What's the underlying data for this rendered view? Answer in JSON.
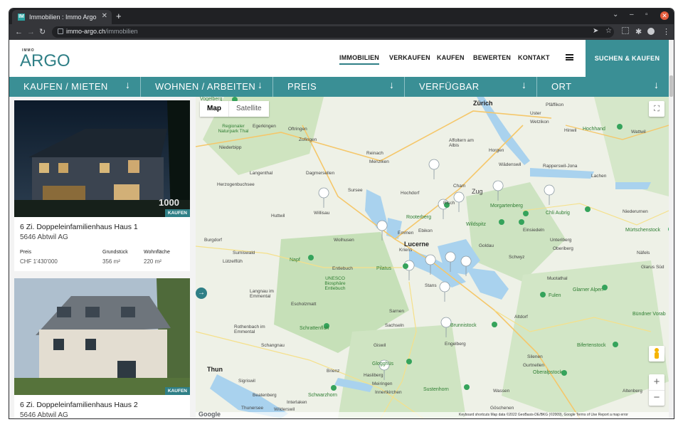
{
  "browser": {
    "tab_title": "Immobilien : Immo Argo",
    "favicon_text": "IM",
    "url_host": "immo-argo.ch",
    "url_path": "/immobilien"
  },
  "site": {
    "logo_small": "IMMO",
    "logo": "ARGO",
    "nav": [
      {
        "label": "IMMOBILIEN",
        "active": true
      },
      {
        "label": "VERKAUFEN",
        "active": false
      },
      {
        "label": "KAUFEN",
        "active": false
      },
      {
        "label": "BEWERTEN",
        "active": false
      },
      {
        "label": "KONTAKT",
        "active": false
      }
    ],
    "cta": "SUCHEN & KAUFEN"
  },
  "filters": [
    {
      "label": "KAUFEN / MIETEN"
    },
    {
      "label": "WOHNEN / ARBEITEN"
    },
    {
      "label": "PREIS"
    },
    {
      "label": "VERFÜGBAR"
    },
    {
      "label": "ORT"
    }
  ],
  "listings": [
    {
      "title": "6 Zi. Doppeleinfamilienhaus Haus 1",
      "location": "5646 Abtwil AG",
      "badge": "KAUFEN",
      "watermark": "1000",
      "specs": {
        "price_label": "Preis",
        "price": "CHF 1'430'000",
        "plot_label": "Grundstück",
        "plot": "356 m²",
        "living_label": "Wohnfläche",
        "living": "220 m²"
      }
    },
    {
      "title": "6 Zi. Doppeleinfamilienhaus Haus 2",
      "location": "5646 Abtwil AG",
      "badge": "KAUFEN"
    }
  ],
  "map": {
    "toggle": {
      "map": "Map",
      "satellite": "Satellite"
    },
    "zoom_in": "+",
    "zoom_out": "−",
    "labels": [
      {
        "text": "Zürich",
        "cls": "city"
      },
      {
        "text": "Lucerne",
        "cls": "city"
      },
      {
        "text": "Thun",
        "cls": "city"
      },
      {
        "text": "Vogelberg",
        "cls": "green"
      },
      {
        "text": "Regionaler Naturpark Thal",
        "cls": "park"
      },
      {
        "text": "Egerkingen",
        "cls": ""
      },
      {
        "text": "Oftringen",
        "cls": ""
      },
      {
        "text": "Niederbipp",
        "cls": ""
      },
      {
        "text": "Zofingen",
        "cls": ""
      },
      {
        "text": "Reinach",
        "cls": ""
      },
      {
        "text": "Menziken",
        "cls": ""
      },
      {
        "text": "Langenthal",
        "cls": ""
      },
      {
        "text": "Dagmersellen",
        "cls": ""
      },
      {
        "text": "Herzogenbuchsee",
        "cls": ""
      },
      {
        "text": "Sursee",
        "cls": ""
      },
      {
        "text": "Hochdorf",
        "cls": ""
      },
      {
        "text": "Huttwil",
        "cls": ""
      },
      {
        "text": "Willisau",
        "cls": ""
      },
      {
        "text": "Burgdorf",
        "cls": ""
      },
      {
        "text": "Sumiswald",
        "cls": ""
      },
      {
        "text": "Lützelflüh",
        "cls": ""
      },
      {
        "text": "Wolhusen",
        "cls": ""
      },
      {
        "text": "Emmen",
        "cls": ""
      },
      {
        "text": "Ebikon",
        "cls": ""
      },
      {
        "text": "Kriens",
        "cls": ""
      },
      {
        "text": "Napf",
        "cls": "green"
      },
      {
        "text": "Entlebuch",
        "cls": ""
      },
      {
        "text": "UNESCO Biosphäre Entlebuch",
        "cls": "park"
      },
      {
        "text": "Langnau im Emmental",
        "cls": ""
      },
      {
        "text": "Escholzmatt",
        "cls": ""
      },
      {
        "text": "Pilatus",
        "cls": "green"
      },
      {
        "text": "Stans",
        "cls": ""
      },
      {
        "text": "Sarnen",
        "cls": ""
      },
      {
        "text": "Sachseln",
        "cls": ""
      },
      {
        "text": "Rothenbach im Emmental",
        "cls": ""
      },
      {
        "text": "Schrattenfluh",
        "cls": "green"
      },
      {
        "text": "Schangnau",
        "cls": ""
      },
      {
        "text": "Giswil",
        "cls": ""
      },
      {
        "text": "Glogghüs",
        "cls": "green"
      },
      {
        "text": "Brienz",
        "cls": ""
      },
      {
        "text": "Hasliberg",
        "cls": ""
      },
      {
        "text": "Meiringen",
        "cls": ""
      },
      {
        "text": "Innertkirchen",
        "cls": ""
      },
      {
        "text": "Schwarzhorn",
        "cls": "green"
      },
      {
        "text": "Sigriswil",
        "cls": ""
      },
      {
        "text": "Beatenberg",
        "cls": ""
      },
      {
        "text": "Interlaken",
        "cls": ""
      },
      {
        "text": "Wilderswil",
        "cls": ""
      },
      {
        "text": "Thunersee",
        "cls": ""
      },
      {
        "text": "Affoltern am Albis",
        "cls": ""
      },
      {
        "text": "Horgen",
        "cls": ""
      },
      {
        "text": "Wädenswil",
        "cls": ""
      },
      {
        "text": "Rapperswil-Jona",
        "cls": ""
      },
      {
        "text": "Uster",
        "cls": ""
      },
      {
        "text": "Pfäffikon",
        "cls": ""
      },
      {
        "text": "Wetzikon",
        "cls": ""
      },
      {
        "text": "Hinwil",
        "cls": ""
      },
      {
        "text": "Hochhand",
        "cls": "green"
      },
      {
        "text": "Wattwil",
        "cls": ""
      },
      {
        "text": "Lachen",
        "cls": ""
      },
      {
        "text": "Cham",
        "cls": ""
      },
      {
        "text": "Zug",
        "cls": ""
      },
      {
        "text": "Risch",
        "cls": ""
      },
      {
        "text": "Rooterberg",
        "cls": "green"
      },
      {
        "text": "Morgartenberg",
        "cls": "green"
      },
      {
        "text": "Chli Aubrig",
        "cls": "green"
      },
      {
        "text": "Wildspitz",
        "cls": "green"
      },
      {
        "text": "Goldau",
        "cls": ""
      },
      {
        "text": "Einsiedeln",
        "cls": ""
      },
      {
        "text": "Unteriberg",
        "cls": ""
      },
      {
        "text": "Oberiberg",
        "cls": ""
      },
      {
        "text": "Schwyz",
        "cls": ""
      },
      {
        "text": "Niederurnen",
        "cls": ""
      },
      {
        "text": "Mürtschenstock",
        "cls": "green"
      },
      {
        "text": "Näfels",
        "cls": ""
      },
      {
        "text": "Glarus Süd",
        "cls": ""
      },
      {
        "text": "Muotathal",
        "cls": ""
      },
      {
        "text": "Fulen",
        "cls": "green"
      },
      {
        "text": "Glarner Alpen",
        "cls": "green"
      },
      {
        "text": "Altdorf",
        "cls": ""
      },
      {
        "text": "Bündner Vorab",
        "cls": "green"
      },
      {
        "text": "Brunnistock",
        "cls": "green"
      },
      {
        "text": "Engelberg",
        "cls": ""
      },
      {
        "text": "Bifertenstock",
        "cls": "green"
      },
      {
        "text": "Silenen",
        "cls": ""
      },
      {
        "text": "Gurtnellen",
        "cls": ""
      },
      {
        "text": "Oberalpstock",
        "cls": "green"
      },
      {
        "text": "Sustenhorn",
        "cls": "green"
      },
      {
        "text": "Wassen",
        "cls": ""
      },
      {
        "text": "Göschenen",
        "cls": ""
      },
      {
        "text": "Altenberg",
        "cls": ""
      }
    ],
    "footer": "Keyboard shortcuts   Map data ©2022 GeoBasis-DE/BKG (©2009), Google   Terms of Use   Report a map error",
    "google": "Google"
  },
  "colors": {
    "brand": "#2f7f86",
    "filter_bg": "#3a8f95",
    "cta_bg": "#3a8f95"
  }
}
